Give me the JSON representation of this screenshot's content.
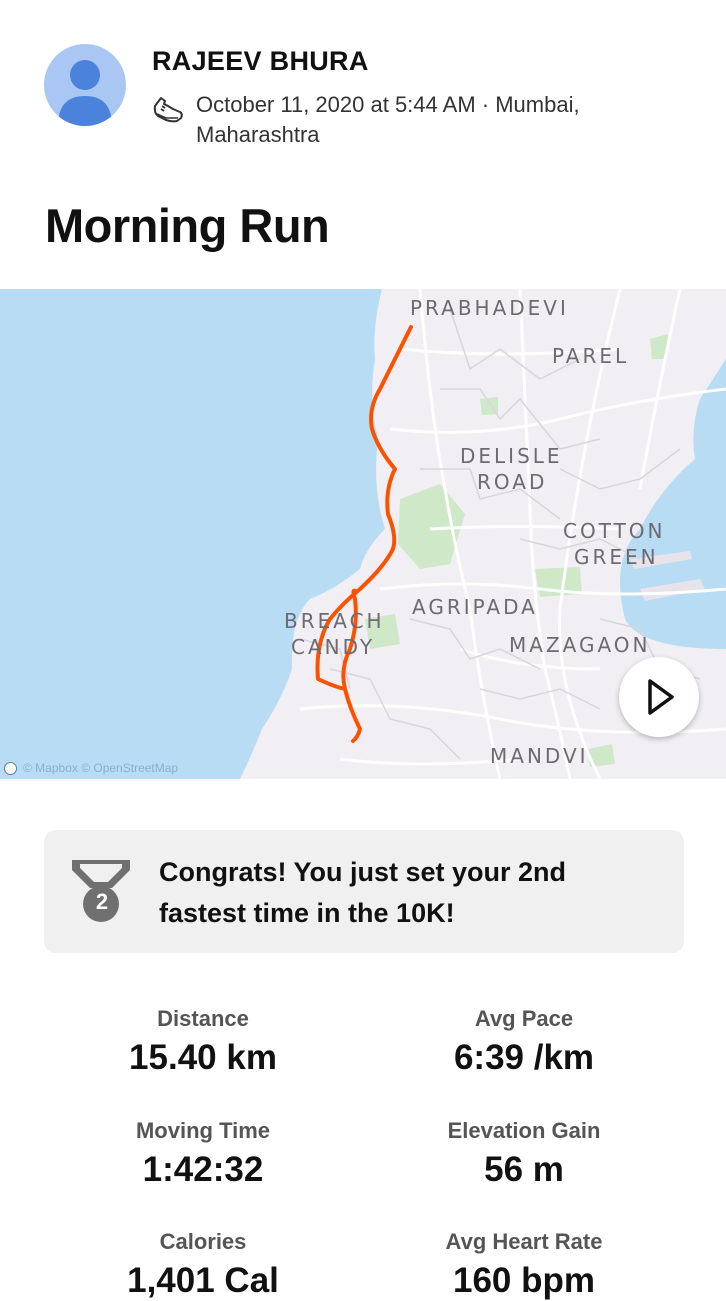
{
  "athlete": {
    "name": "RAJEEV BHURA",
    "date_line_1": "October 11, 2020 at 5:44 AM · Mumbai,",
    "date_line_2": "Maharashtra"
  },
  "activity": {
    "title": "Morning Run"
  },
  "map": {
    "labels": {
      "prabhadevi": "PRABHADEVI",
      "parel": "PAREL",
      "delisle_1": "DELISLE",
      "delisle_2": "ROAD",
      "cotton_1": "COTTON",
      "cotton_2": "GREEN",
      "agripada": "AGRIPADA",
      "breach_1": "BREACH",
      "breach_2": "CANDY",
      "mazagaon": "MAZAGAON",
      "mandvi": "MANDVI"
    },
    "attribution": "© Mapbox © OpenStreetMap",
    "route_color": "#fc5200",
    "water_color": "#b8dcf4",
    "park_color": "#cfe8c8"
  },
  "achievement": {
    "rank": "2",
    "text": "Congrats! You just set your 2nd fastest time in the 10K!"
  },
  "stats": [
    {
      "label": "Distance",
      "value": "15.40 km"
    },
    {
      "label": "Avg Pace",
      "value": "6:39 /km"
    },
    {
      "label": "Moving Time",
      "value": "1:42:32"
    },
    {
      "label": "Elevation Gain",
      "value": "56 m"
    },
    {
      "label": "Calories",
      "value": "1,401 Cal"
    },
    {
      "label": "Avg Heart Rate",
      "value": "160 bpm"
    }
  ]
}
